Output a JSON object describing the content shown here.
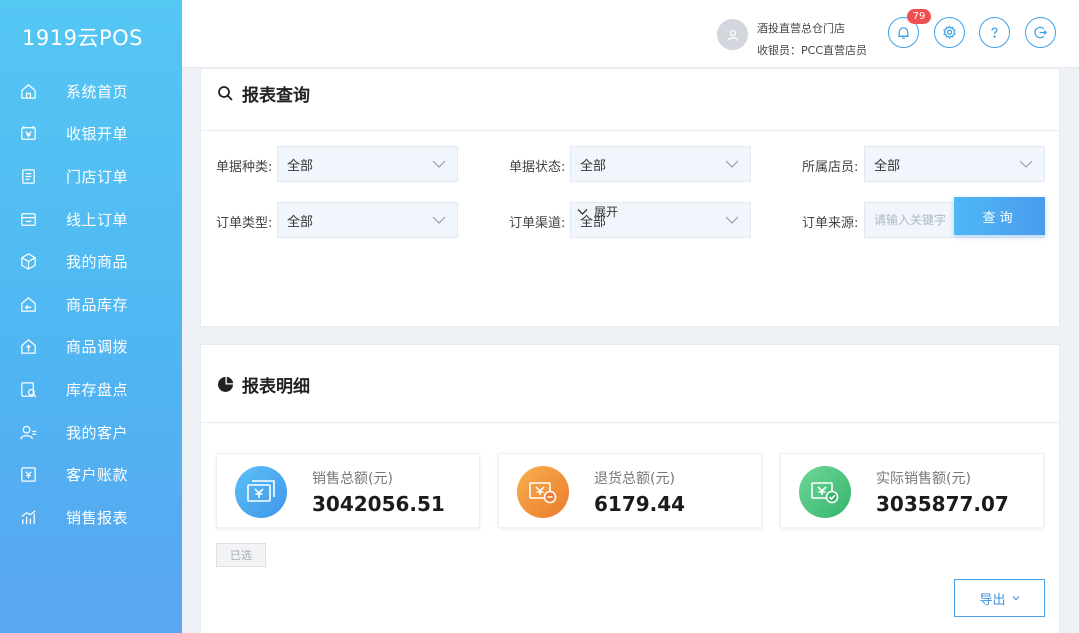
{
  "app": {
    "logo": "1919云POS"
  },
  "sidebar": {
    "items": [
      {
        "label": "系统首页",
        "icon": "home-icon"
      },
      {
        "label": "收银开单",
        "icon": "cashier-icon"
      },
      {
        "label": "门店订单",
        "icon": "store-order-icon"
      },
      {
        "label": "线上订单",
        "icon": "online-order-icon"
      },
      {
        "label": "我的商品",
        "icon": "product-box-icon"
      },
      {
        "label": "商品库存",
        "icon": "inventory-icon"
      },
      {
        "label": "商品调拨",
        "icon": "transfer-icon"
      },
      {
        "label": "库存盘点",
        "icon": "stocktake-icon"
      },
      {
        "label": "我的客户",
        "icon": "customer-icon"
      },
      {
        "label": "客户账款",
        "icon": "account-icon"
      },
      {
        "label": "销售报表",
        "icon": "report-chart-icon"
      }
    ]
  },
  "header": {
    "store_name": "酒投直营总仓门店",
    "cashier": "收银员：PCC直营店员",
    "notification_count": "79"
  },
  "query": {
    "title": "报表查询",
    "filters": {
      "doc_type": {
        "label": "单据种类:",
        "value": "全部"
      },
      "doc_status": {
        "label": "单据状态:",
        "value": "全部"
      },
      "clerk": {
        "label": "所属店员:",
        "value": "全部"
      },
      "order_type": {
        "label": "订单类型:",
        "value": "全部"
      },
      "order_channel": {
        "label": "订单渠道:",
        "value": "全部"
      },
      "order_source": {
        "label": "订单来源:",
        "placeholder": "请输入关键字"
      }
    },
    "expand_label": "展开",
    "submit_label": "查询"
  },
  "detail": {
    "title": "报表明细",
    "stats": [
      {
        "label": "销售总额(元)",
        "value": "3042056.51",
        "icon": "money-card-icon",
        "color": "#4aa8ee"
      },
      {
        "label": "退货总额(元)",
        "value": "6179.44",
        "icon": "refund-icon",
        "color": "#f08a36"
      },
      {
        "label": "实际销售额(元)",
        "value": "3035877.07",
        "icon": "verified-money-icon",
        "color": "#3fbd73"
      }
    ],
    "selected_label": "已选",
    "export_label": "导出"
  }
}
